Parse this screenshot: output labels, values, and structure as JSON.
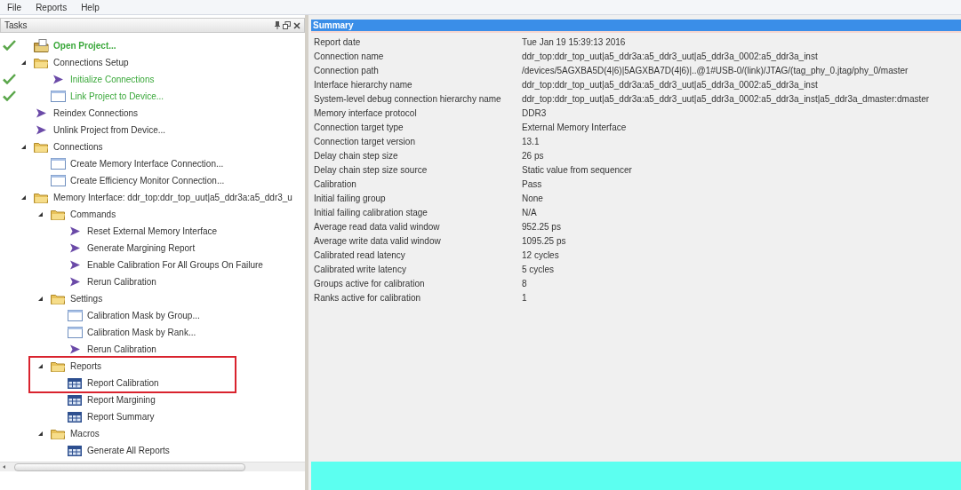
{
  "menu": [
    "File",
    "Reports",
    "Help"
  ],
  "tasks_panel": {
    "title": "Tasks",
    "tree": [
      {
        "label": "Open Project...",
        "kind": "project",
        "done": true,
        "bold": true
      },
      {
        "label": "Connections Setup",
        "kind": "folder",
        "expanded": true,
        "done": false,
        "children": [
          {
            "label": "Initialize Connections",
            "kind": "action",
            "done": true
          },
          {
            "label": "Link Project to Device...",
            "kind": "dialog",
            "done": true
          }
        ]
      },
      {
        "label": "Reindex Connections",
        "kind": "action",
        "done": false
      },
      {
        "label": "Unlink Project from Device...",
        "kind": "action",
        "done": false
      },
      {
        "label": "Connections",
        "kind": "folder",
        "expanded": true,
        "done": false,
        "children": [
          {
            "label": "Create Memory Interface Connection...",
            "kind": "dialog",
            "done": false
          },
          {
            "label": "Create Efficiency Monitor Connection...",
            "kind": "dialog",
            "done": false
          }
        ]
      },
      {
        "label": "Memory Interface: ddr_top:ddr_top_uut|a5_ddr3a:a5_ddr3_u",
        "kind": "folder",
        "expanded": true,
        "done": false,
        "children": [
          {
            "label": "Commands",
            "kind": "folder",
            "expanded": true,
            "done": false,
            "children": [
              {
                "label": "Reset External Memory Interface",
                "kind": "action",
                "done": false
              },
              {
                "label": "Generate Margining Report",
                "kind": "action",
                "done": false
              },
              {
                "label": "Enable Calibration For All Groups On Failure",
                "kind": "action",
                "done": false
              },
              {
                "label": "Rerun Calibration",
                "kind": "action",
                "done": false
              }
            ]
          },
          {
            "label": "Settings",
            "kind": "folder",
            "expanded": true,
            "done": false,
            "children": [
              {
                "label": "Calibration Mask by Group...",
                "kind": "dialog",
                "done": false
              },
              {
                "label": "Calibration Mask by Rank...",
                "kind": "dialog",
                "done": false
              },
              {
                "label": "Rerun Calibration",
                "kind": "action",
                "done": false
              }
            ]
          },
          {
            "label": "Reports",
            "kind": "folder",
            "expanded": true,
            "done": false,
            "highlighted": true,
            "children": [
              {
                "label": "Report Calibration",
                "kind": "report",
                "done": false,
                "highlighted": true
              },
              {
                "label": "Report Margining",
                "kind": "report",
                "done": false
              },
              {
                "label": "Report Summary",
                "kind": "report",
                "done": false
              }
            ]
          },
          {
            "label": "Macros",
            "kind": "folder",
            "expanded": true,
            "done": false,
            "children": [
              {
                "label": "Generate All Reports",
                "kind": "report",
                "done": false
              }
            ]
          }
        ]
      }
    ]
  },
  "summary": {
    "title": "Summary",
    "rows": [
      {
        "label": "Report date",
        "value": "Tue Jan 19 15:39:13 2016"
      },
      {
        "label": "Connection name",
        "value": "ddr_top:ddr_top_uut|a5_ddr3a:a5_ddr3_uut|a5_ddr3a_0002:a5_ddr3a_inst"
      },
      {
        "label": "Connection path",
        "value": "/devices/5AGXBA5D(4|6)|5AGXBA7D(4|6)|..@1#USB-0/(link)/JTAG/(tag_phy_0.jtag/phy_0/master"
      },
      {
        "label": "Interface hierarchy name",
        "value": "ddr_top:ddr_top_uut|a5_ddr3a:a5_ddr3_uut|a5_ddr3a_0002:a5_ddr3a_inst"
      },
      {
        "label": "System-level debug connection hierarchy name",
        "value": "ddr_top:ddr_top_uut|a5_ddr3a:a5_ddr3_uut|a5_ddr3a_0002:a5_ddr3a_inst|a5_ddr3a_dmaster:dmaster"
      },
      {
        "label": "Memory interface protocol",
        "value": "DDR3"
      },
      {
        "label": "Connection target type",
        "value": "External Memory Interface"
      },
      {
        "label": "Connection target version",
        "value": "13.1"
      },
      {
        "label": "Delay chain step size",
        "value": "26 ps"
      },
      {
        "label": "Delay chain step size source",
        "value": "Static value from sequencer"
      },
      {
        "label": "Calibration",
        "value": "Pass"
      },
      {
        "label": "Initial failing group",
        "value": "None"
      },
      {
        "label": "Initial failing calibration stage",
        "value": "N/A"
      },
      {
        "label": "Average read data valid window",
        "value": "952.25 ps"
      },
      {
        "label": "Average write data valid window",
        "value": "1095.25 ps"
      },
      {
        "label": "Calibrated read latency",
        "value": "12 cycles"
      },
      {
        "label": "Calibrated write latency",
        "value": "5 cycles"
      },
      {
        "label": "Groups active for calibration",
        "value": "8"
      },
      {
        "label": "Ranks active for calibration",
        "value": "1"
      }
    ]
  }
}
